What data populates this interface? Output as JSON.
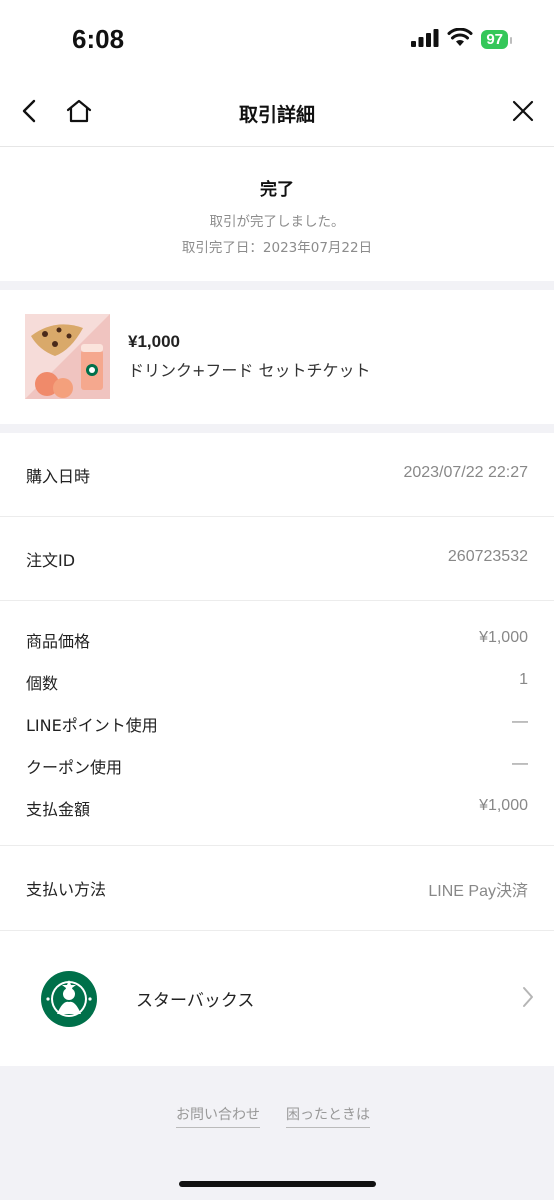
{
  "status_bar": {
    "time": "6:08",
    "battery": "97"
  },
  "nav": {
    "title": "取引詳細"
  },
  "status": {
    "title": "完了",
    "message": "取引が完了しました。",
    "date_label": "取引完了日：2023年07月22日"
  },
  "product": {
    "price": "¥1,000",
    "name": "ドリンク+フード セットチケット"
  },
  "details": {
    "purchase_datetime": {
      "label": "購入日時",
      "value": "2023/07/22 22:27"
    },
    "order_id": {
      "label": "注文ID",
      "value": "260723532"
    },
    "item_price": {
      "label": "商品価格",
      "value": "¥1,000"
    },
    "quantity": {
      "label": "個数",
      "value": "1"
    },
    "line_points": {
      "label": "LINEポイント使用",
      "value": "—"
    },
    "coupon": {
      "label": "クーポン使用",
      "value": "—"
    },
    "paid_amount": {
      "label": "支払金額",
      "value": "¥1,000"
    },
    "payment_method": {
      "label": "支払い方法",
      "value": "LINE Pay決済"
    }
  },
  "merchant": {
    "name": "スターバックス"
  },
  "footer": {
    "contact": "お問い合わせ",
    "help": "困ったときは"
  },
  "colors": {
    "battery_green": "#34c759",
    "starbucks_green": "#00704a",
    "section_gap": "#f2f2f6"
  },
  "icons": [
    "back-chevron-icon",
    "home-icon",
    "close-icon",
    "signal-icon",
    "wifi-icon",
    "battery-icon",
    "chevron-right-icon",
    "starbucks-logo"
  ]
}
